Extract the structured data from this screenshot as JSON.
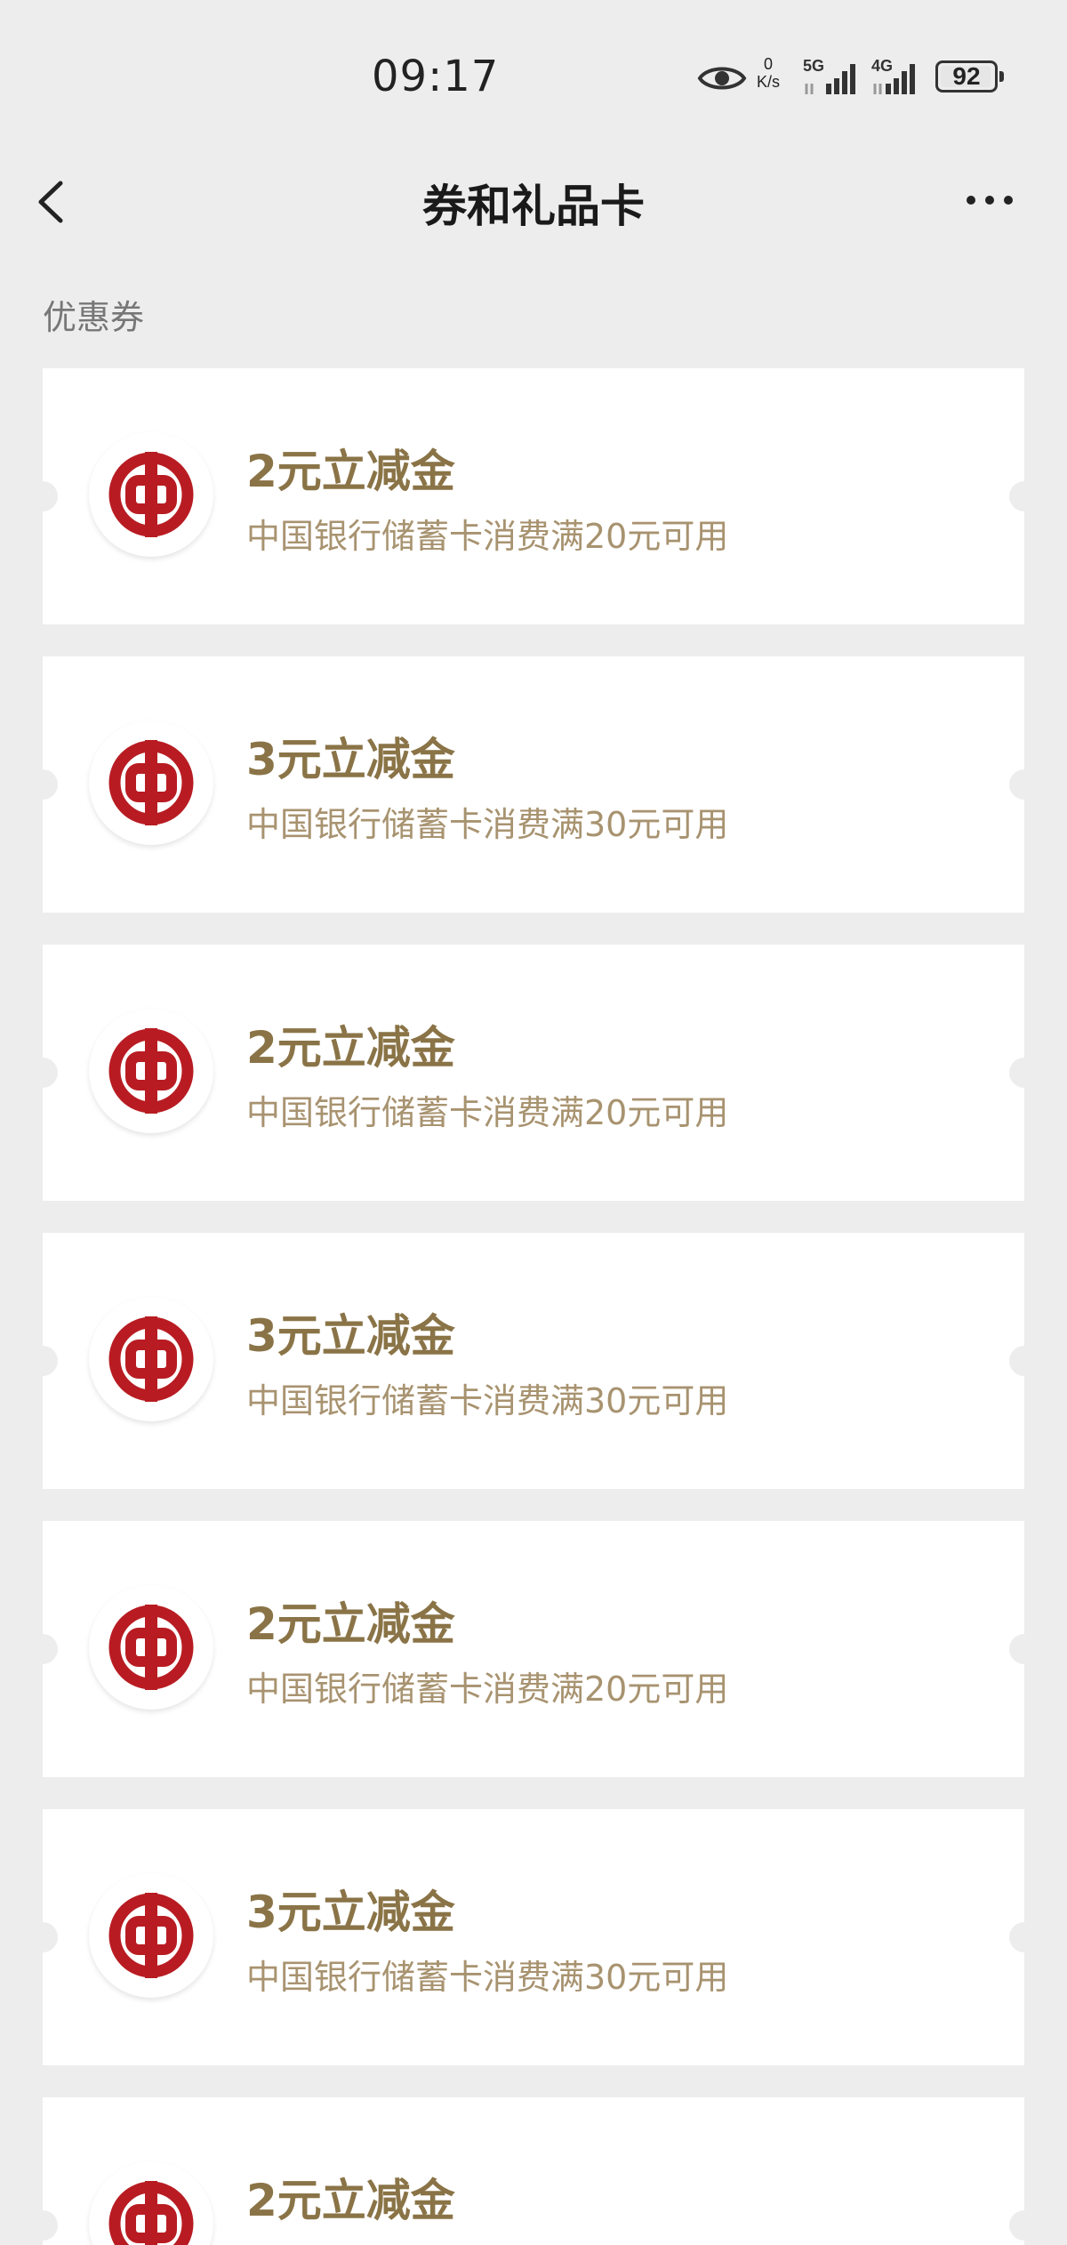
{
  "status": {
    "time": "09:17",
    "net_speed_value": "0",
    "net_speed_unit": "K/s",
    "net_5g": "5G",
    "net_4g": "4G",
    "battery": "92"
  },
  "nav": {
    "title": "券和礼品卡"
  },
  "section_label": "优惠券",
  "colors": {
    "page_bg": "#ededed",
    "card_bg": "#ffffff",
    "coupon_title": "#8a7447",
    "coupon_desc": "#a89370",
    "bank_red": "#b81c22"
  },
  "coupons": [
    {
      "title": "2元立减金",
      "desc": "中国银行储蓄卡消费满20元可用",
      "icon": "bank-of-china-logo"
    },
    {
      "title": "3元立减金",
      "desc": "中国银行储蓄卡消费满30元可用",
      "icon": "bank-of-china-logo"
    },
    {
      "title": "2元立减金",
      "desc": "中国银行储蓄卡消费满20元可用",
      "icon": "bank-of-china-logo"
    },
    {
      "title": "3元立减金",
      "desc": "中国银行储蓄卡消费满30元可用",
      "icon": "bank-of-china-logo"
    },
    {
      "title": "2元立减金",
      "desc": "中国银行储蓄卡消费满20元可用",
      "icon": "bank-of-china-logo"
    },
    {
      "title": "3元立减金",
      "desc": "中国银行储蓄卡消费满30元可用",
      "icon": "bank-of-china-logo"
    },
    {
      "title": "2元立减金",
      "desc": "",
      "icon": "bank-of-china-logo"
    }
  ]
}
